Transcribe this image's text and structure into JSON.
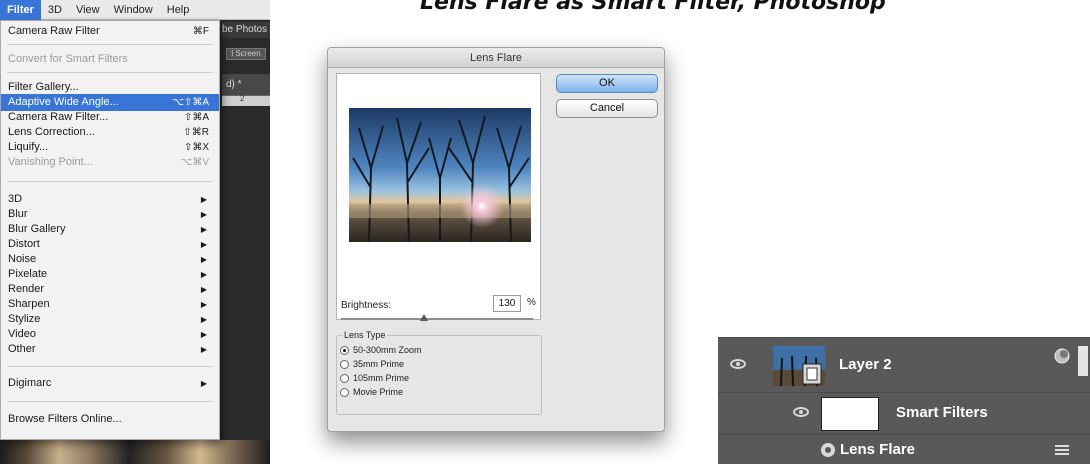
{
  "caption": "Lens Flare as Smart Filter, Photoshop",
  "menubar": {
    "items": [
      "Filter",
      "3D",
      "View",
      "Window",
      "Help"
    ],
    "active": "Filter"
  },
  "background_window": {
    "title_fragment": "be Photos",
    "button_fragment": "l Screen",
    "tab_fragment": "d) *",
    "ruler_mark": "2"
  },
  "filter_menu": {
    "camera_raw_top": {
      "label": "Camera Raw Filter",
      "shortcut": "⌘F"
    },
    "convert_smart": {
      "label": "Convert for Smart Filters"
    },
    "filter_gallery": {
      "label": "Filter Gallery..."
    },
    "adaptive_wide": {
      "label": "Adaptive Wide Angle...",
      "shortcut": "⌥⇧⌘A"
    },
    "camera_raw": {
      "label": "Camera Raw Filter...",
      "shortcut": "⇧⌘A"
    },
    "lens_correction": {
      "label": "Lens Correction...",
      "shortcut": "⇧⌘R"
    },
    "liquify": {
      "label": "Liquify...",
      "shortcut": "⇧⌘X"
    },
    "vanishing_point": {
      "label": "Vanishing Point...",
      "shortcut": "⌥⌘V"
    },
    "submenus": [
      "3D",
      "Blur",
      "Blur Gallery",
      "Distort",
      "Noise",
      "Pixelate",
      "Render",
      "Sharpen",
      "Stylize",
      "Video",
      "Other"
    ],
    "digimarc": {
      "label": "Digimarc"
    },
    "browse": {
      "label": "Browse Filters Online..."
    }
  },
  "dialog": {
    "title": "Lens Flare",
    "ok_label": "OK",
    "cancel_label": "Cancel",
    "brightness_label": "Brightness:",
    "brightness_value": "130",
    "brightness_unit": "%",
    "brightness_slider_fraction": 0.43,
    "lens_type_label": "Lens Type",
    "lens_options": [
      "50-300mm Zoom",
      "35mm Prime",
      "105mm Prime",
      "Movie Prime"
    ],
    "selected_lens": "50-300mm Zoom"
  },
  "layers_panel": {
    "layer_name": "Layer 2",
    "smart_filters_label": "Smart Filters",
    "filter_name": "Lens Flare"
  },
  "colors": {
    "menu_highlight": "#3875d7",
    "ok_button": "#7fb1ec",
    "layers_bg": "#595959"
  }
}
